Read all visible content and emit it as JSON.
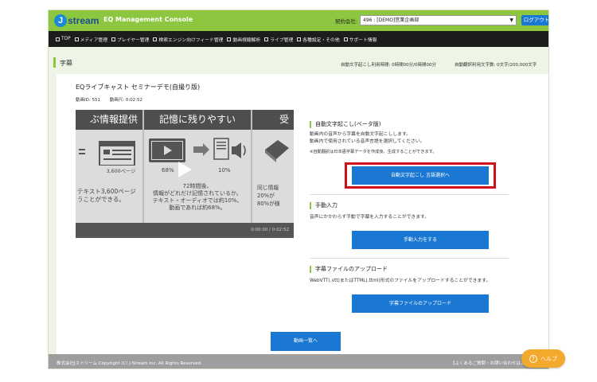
{
  "header": {
    "logo_text": "stream",
    "logo_j": "J",
    "console_title": "EQ Management Console",
    "contract_label": "契約会社:",
    "contract_value": "496 : [DEMO]営業企画部",
    "logout_label": "ログアウト"
  },
  "nav": {
    "items": [
      {
        "label": "TOP"
      },
      {
        "label": "メディア管理"
      },
      {
        "label": "プレイヤー管理"
      },
      {
        "label": "検索エンジン向けフィード管理"
      },
      {
        "label": "動画視聴解析"
      },
      {
        "label": "ライブ管理"
      },
      {
        "label": "各種設定・その他"
      },
      {
        "label": "サポート情報"
      }
    ]
  },
  "section": {
    "title": "字幕",
    "usage_time": "自動文字起こし利用時間: 0時間00分/0時間00分",
    "usage_chars": "自動翻訳利用文字数: 0文字/200,000文字"
  },
  "video": {
    "title": "EQライブキャスト セミナーデモ(自撮り版)",
    "id_text": "動画ID: 551",
    "length_text": "動画尺: 0:02:52",
    "time_display": "0:00:00 / 0:02:52",
    "slides": [
      {
        "head": "ぶ情報提供",
        "body": [
          "3,600ページ",
          "テキスト3,600ページ",
          "うことができる。"
        ]
      },
      {
        "head": "記憶に残りやすい",
        "body": [
          "68%",
          "10%",
          "72時間後、",
          "情報がどれだけ記憶されているか。",
          "テキスト・オーディオでは約10%、",
          "動画であれば約68%。"
        ]
      },
      {
        "head": "受",
        "body": [
          "同じ情報",
          "20%が",
          "80%が様"
        ]
      }
    ]
  },
  "auto_caption": {
    "heading": "自動文字起こし(ベータ版)",
    "desc1": "動画内の音声から字幕を自動文字起こしします。",
    "desc2": "動画内で使用されている音声言語を選択してください。",
    "note": "※自動翻訳は日本語字幕データを作成後、生成することができます。",
    "button": "自動文字起こし 言語選択へ"
  },
  "manual_input": {
    "heading": "手動入力",
    "desc": "音声にかかわらず手動で字幕を入力することができます。",
    "button": "手動入力をする"
  },
  "upload": {
    "heading": "字幕ファイルのアップロード",
    "desc": "WebVTT(.vtt)またはTTML(.ttml)形式のファイルをアップロードすることができます。",
    "button": "字幕ファイルのアップロード"
  },
  "list_button": "動画一覧へ",
  "footer": {
    "copyright": "株式会社Jストリーム Copyright (C) J-Stream Inc. All Rights Reserved.",
    "link": "【よくあるご質問・お問い合わせはこちら】"
  },
  "help_label": "ヘルプ",
  "help_icon": "?",
  "colors": {
    "brand_green": "#8dc63f",
    "primary_blue": "#1a78d2",
    "highlight_red": "#d0101a",
    "help_orange": "#f3a92b"
  }
}
